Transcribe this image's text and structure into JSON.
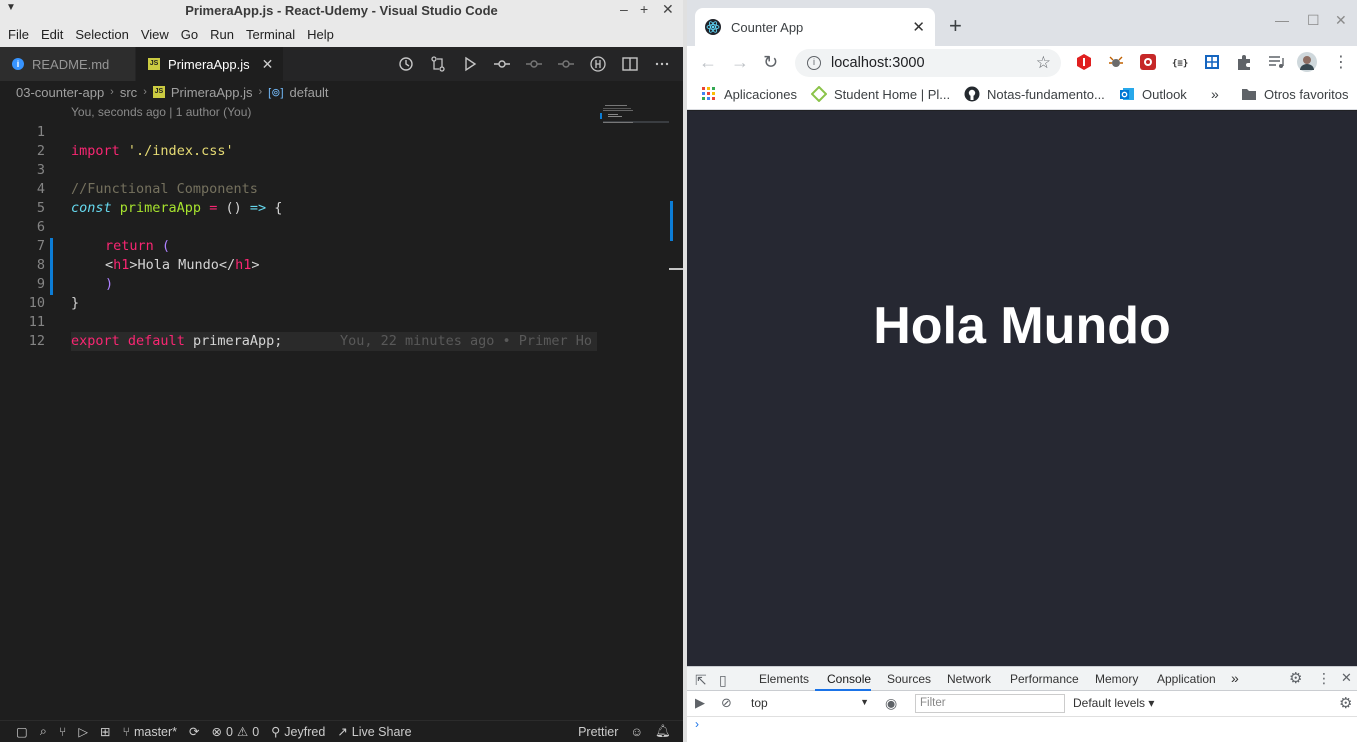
{
  "vscode": {
    "window_title": "PrimeraApp.js - React-Udemy - Visual Studio Code",
    "menu": [
      "File",
      "Edit",
      "Selection",
      "View",
      "Go",
      "Run",
      "Terminal",
      "Help"
    ],
    "tabs": [
      {
        "label": "README.md",
        "active": false
      },
      {
        "label": "PrimeraApp.js",
        "active": true
      }
    ],
    "breadcrumb": [
      "03-counter-app",
      "src",
      "PrimeraApp.js",
      "default"
    ],
    "codelens": "You, seconds ago | 1 author (You)",
    "blame": "You, 22 minutes ago • Primer Ho",
    "line_numbers": [
      "1",
      "2",
      "3",
      "4",
      "5",
      "6",
      "7",
      "8",
      "9",
      "10",
      "11",
      "12"
    ],
    "code": {
      "l2_kw": "import",
      "l2_str": "'./index.css'",
      "l4_cmt": "//Functional Components",
      "l5_const": "const",
      "l5_name": "primeraApp",
      "l5_eq": "=",
      "l5_paren": "()",
      "l5_arrow": "=>",
      "l5_brace": "{",
      "l7_return": "return",
      "l7_paren": "(",
      "l8_lt": "<",
      "l8_tag_open": "h1",
      "l8_gt": ">",
      "l8_text": "Hola Mundo",
      "l8_lt2": "</",
      "l8_tag_close": "h1",
      "l8_gt2": ">",
      "l9_paren": ")",
      "l10_brace": "}",
      "l12_export": "export",
      "l12_default": "default",
      "l12_name": "primeraApp;"
    },
    "status": {
      "branch": "master*",
      "errors": "0",
      "warnings": "0",
      "user": "Jeyfred",
      "live_share": "Live Share",
      "formatter": "Prettier"
    }
  },
  "chrome": {
    "tab_title": "Counter App",
    "url": "localhost:3000",
    "bookmarks": [
      "Aplicaciones",
      "Student Home | Pl...",
      "Notas-fundamento...",
      "Outlook"
    ],
    "bookmarks_more": "»",
    "other_bookmarks": "Otros favoritos",
    "page_heading": "Hola Mundo",
    "devtools": {
      "tabs": [
        "Elements",
        "Console",
        "Sources",
        "Network",
        "Performance",
        "Memory",
        "Application"
      ],
      "active_tab": "Console",
      "more": "»",
      "context": "top",
      "filter_placeholder": "Filter",
      "levels": "Default levels ▾",
      "prompt": "›"
    }
  }
}
